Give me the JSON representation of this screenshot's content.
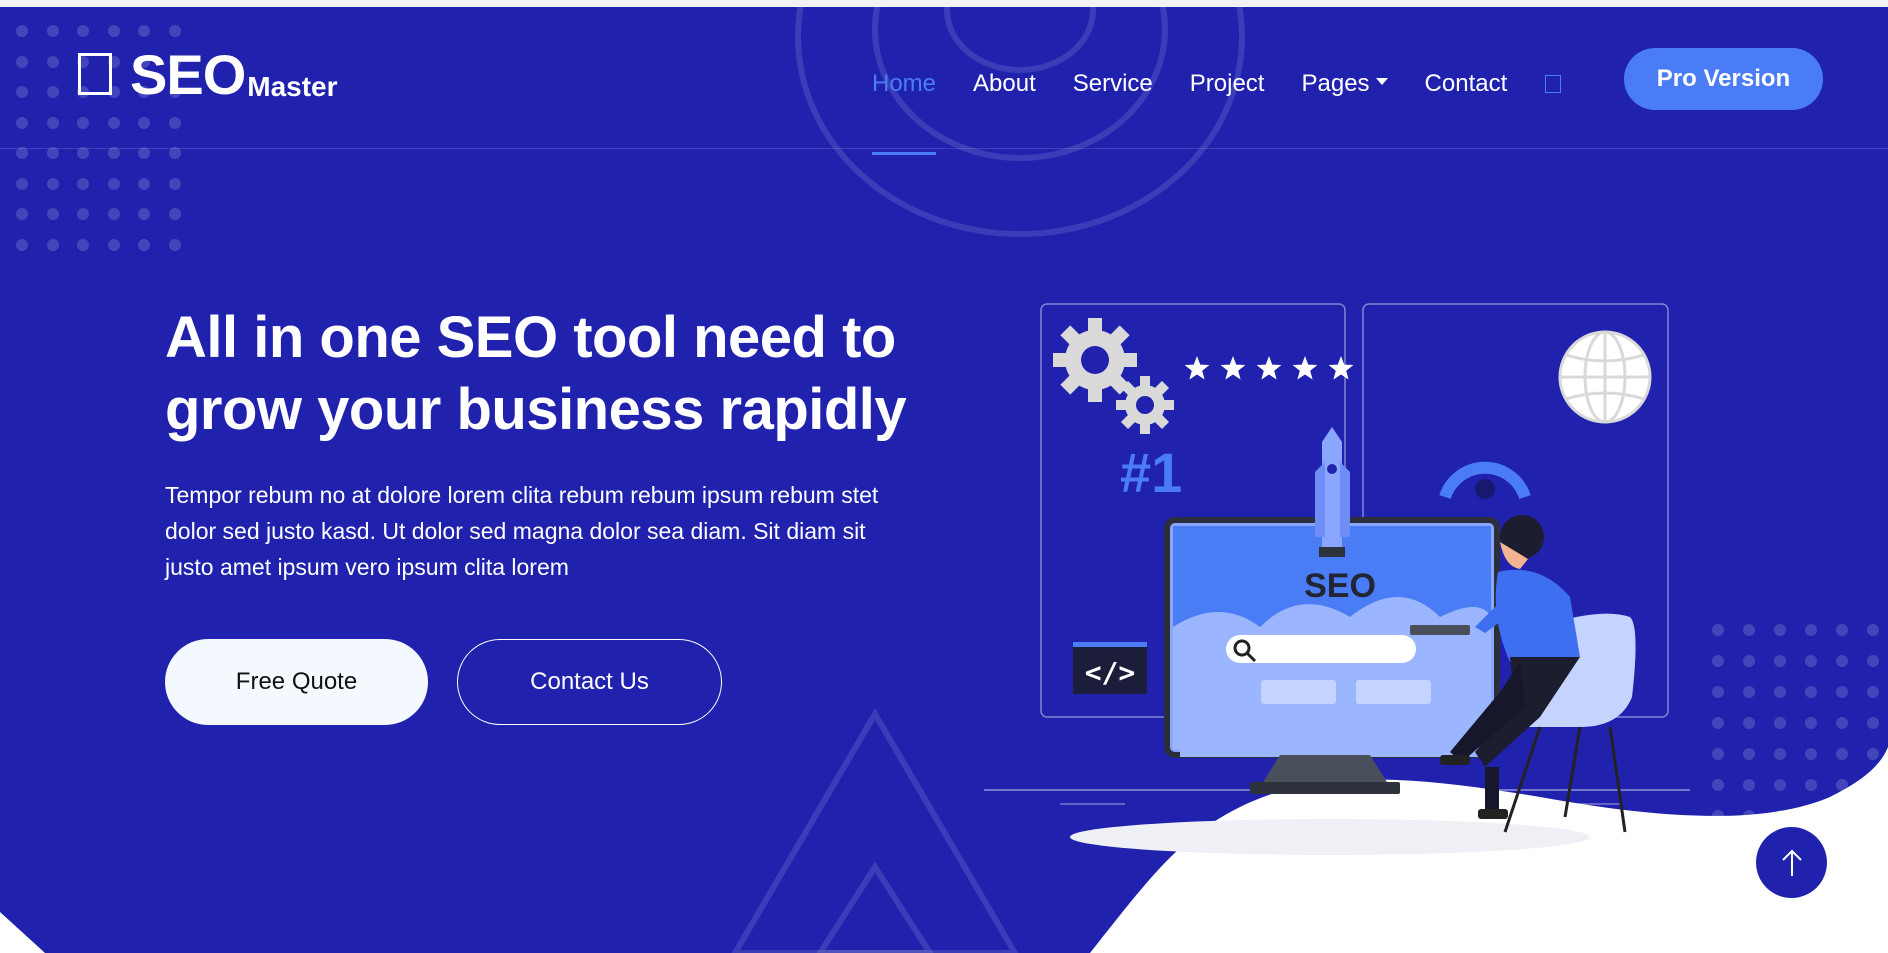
{
  "brand": {
    "main": "SEO",
    "sub": "Master",
    "icon": "brand-square-icon"
  },
  "nav": {
    "items": [
      {
        "label": "Home",
        "active": true
      },
      {
        "label": "About",
        "active": false
      },
      {
        "label": "Service",
        "active": false
      },
      {
        "label": "Project",
        "active": false
      },
      {
        "label": "Pages",
        "active": false
      },
      {
        "label": "Contact",
        "active": false
      }
    ],
    "search_icon": "search-icon",
    "cta": "Pro Version"
  },
  "hero": {
    "headline_line1": "All in one SEO tool need to",
    "headline_line2": "grow your business rapidly",
    "description": "Tempor rebum no at dolore lorem clita rebum rebum ipsum rebum stet dolor sed justo kasd. Ut dolor sed magna dolor sea diam. Sit diam sit justo amet ipsum vero ipsum clita lorem",
    "primary_button": "Free Quote",
    "secondary_button": "Contact Us"
  },
  "illustration": {
    "seo_label": "SEO",
    "rank_label": "#1",
    "code_label": "</>",
    "rating_stars": 5
  },
  "back_to_top_icon": "arrow-up-icon",
  "colors": {
    "hero_bg": "#2022ae",
    "accent": "#4a7cf5",
    "button_light": "#f4f8ff",
    "white": "#ffffff"
  }
}
